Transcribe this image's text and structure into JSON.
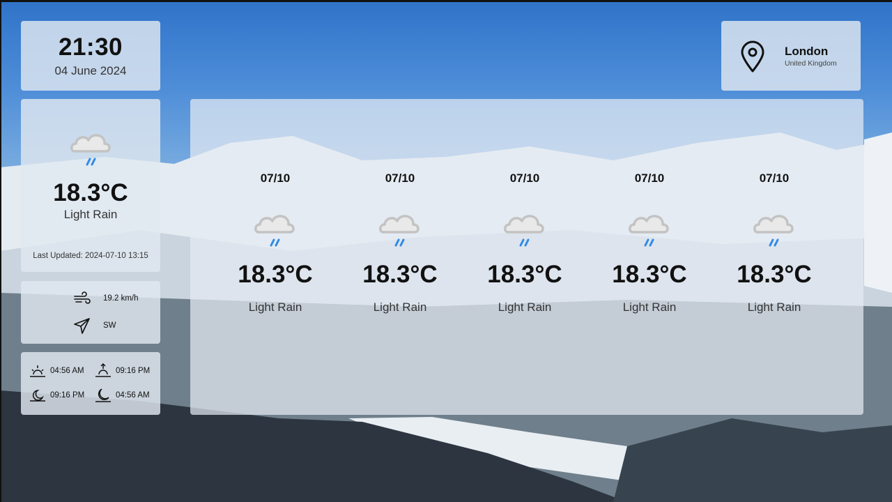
{
  "clock": {
    "time": "21:30",
    "date": "04 June 2024"
  },
  "current": {
    "icon": "cloud-rain-icon",
    "temperature": "18.3°C",
    "condition": "Light Rain",
    "last_updated": "Last Updated: 2024-07-10 13:15"
  },
  "wind": {
    "speed": "19.2 km/h",
    "direction": "SW"
  },
  "sun_moon": {
    "sunrise": "04:56 AM",
    "sunset": "09:16 PM",
    "moonrise": "09:16 PM",
    "moonset": "04:56 AM"
  },
  "location": {
    "city": "London",
    "country": "United Kingdom"
  },
  "forecast": [
    {
      "date": "07/10",
      "icon": "cloud-rain-icon",
      "temperature": "18.3°C",
      "condition": "Light Rain"
    },
    {
      "date": "07/10",
      "icon": "cloud-rain-icon",
      "temperature": "18.3°C",
      "condition": "Light Rain"
    },
    {
      "date": "07/10",
      "icon": "cloud-rain-icon",
      "temperature": "18.3°C",
      "condition": "Light Rain"
    },
    {
      "date": "07/10",
      "icon": "cloud-rain-icon",
      "temperature": "18.3°C",
      "condition": "Light Rain"
    },
    {
      "date": "07/10",
      "icon": "cloud-rain-icon",
      "temperature": "18.3°C",
      "condition": "Light Rain"
    }
  ],
  "colors": {
    "rain_accent": "#2f8ae6",
    "cloud_gray": "#c7c7c7",
    "card_bg": "#e1e8f0",
    "sky": "#2f73c9"
  }
}
